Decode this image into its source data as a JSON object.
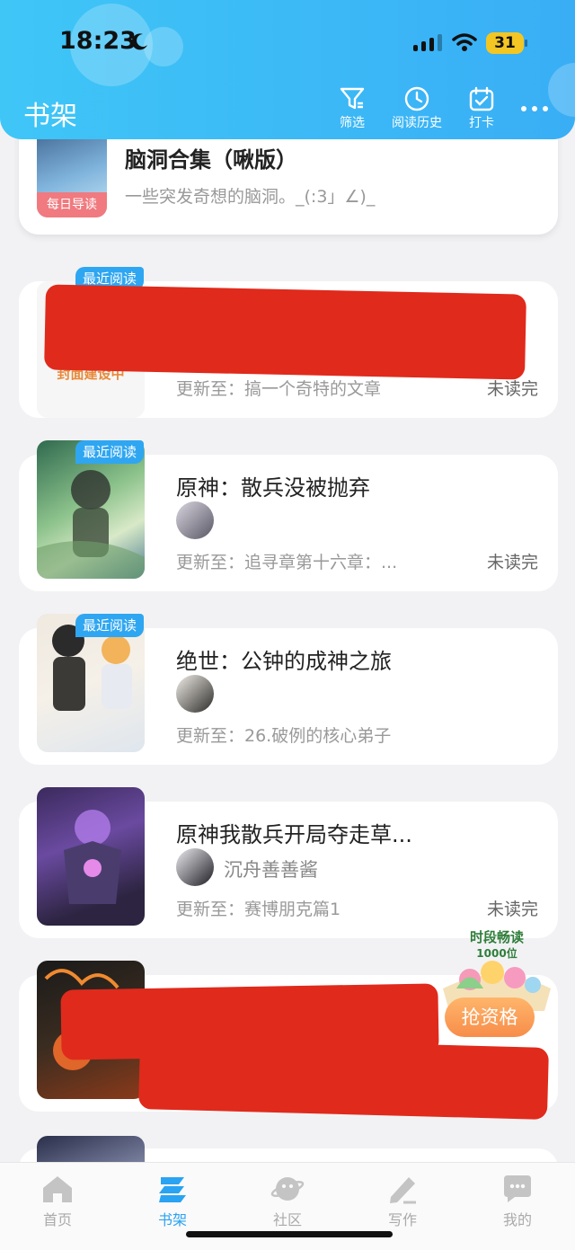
{
  "status_bar": {
    "time": "18:23",
    "battery": "31"
  },
  "header": {
    "title": "书架",
    "actions": [
      {
        "label": "筛选",
        "icon": "filter-icon"
      },
      {
        "label": "阅读历史",
        "icon": "history-clock-icon"
      },
      {
        "label": "打卡",
        "icon": "calendar-check-icon"
      }
    ],
    "more_icon": "more-dots-icon"
  },
  "featured": {
    "title": "脑洞合集（啾版）",
    "desc": "一些突发奇想的脑洞。_(:3」∠)_",
    "badge": "每日导读"
  },
  "books": [
    {
      "badge": "最近阅读",
      "cover_text": "封面建设中",
      "update": "更新至：搞一个奇特的文章",
      "status": "未读完"
    },
    {
      "badge": "最近阅读",
      "title": "原神：散兵没被抛弃",
      "update": "更新至：追寻章第十六章：...",
      "status": "未读完"
    },
    {
      "badge": "最近阅读",
      "title": "绝世：公钟的成神之旅",
      "update": "更新至：26.破例的核心弟子"
    },
    {
      "title": "原神我散兵开局夺走草...",
      "author": "沉舟善善酱",
      "update": "更新至：赛博朋克篇1",
      "status": "未读完"
    }
  ],
  "promo": {
    "line1": "时段畅读",
    "line2": "1000位",
    "button": "抢资格"
  },
  "tabbar": {
    "tabs": [
      {
        "label": "首页",
        "icon": "home-icon"
      },
      {
        "label": "书架",
        "icon": "bookshelf-icon"
      },
      {
        "label": "社区",
        "icon": "planet-icon"
      },
      {
        "label": "写作",
        "icon": "pen-icon"
      },
      {
        "label": "我的",
        "icon": "chat-bubble-icon"
      }
    ],
    "active": "书架"
  },
  "colors": {
    "accent": "#2aa3f3",
    "header_gradient_start": "#3fc6f7",
    "redaction": "#e02a1c",
    "promo_button": "#f78d4a"
  }
}
